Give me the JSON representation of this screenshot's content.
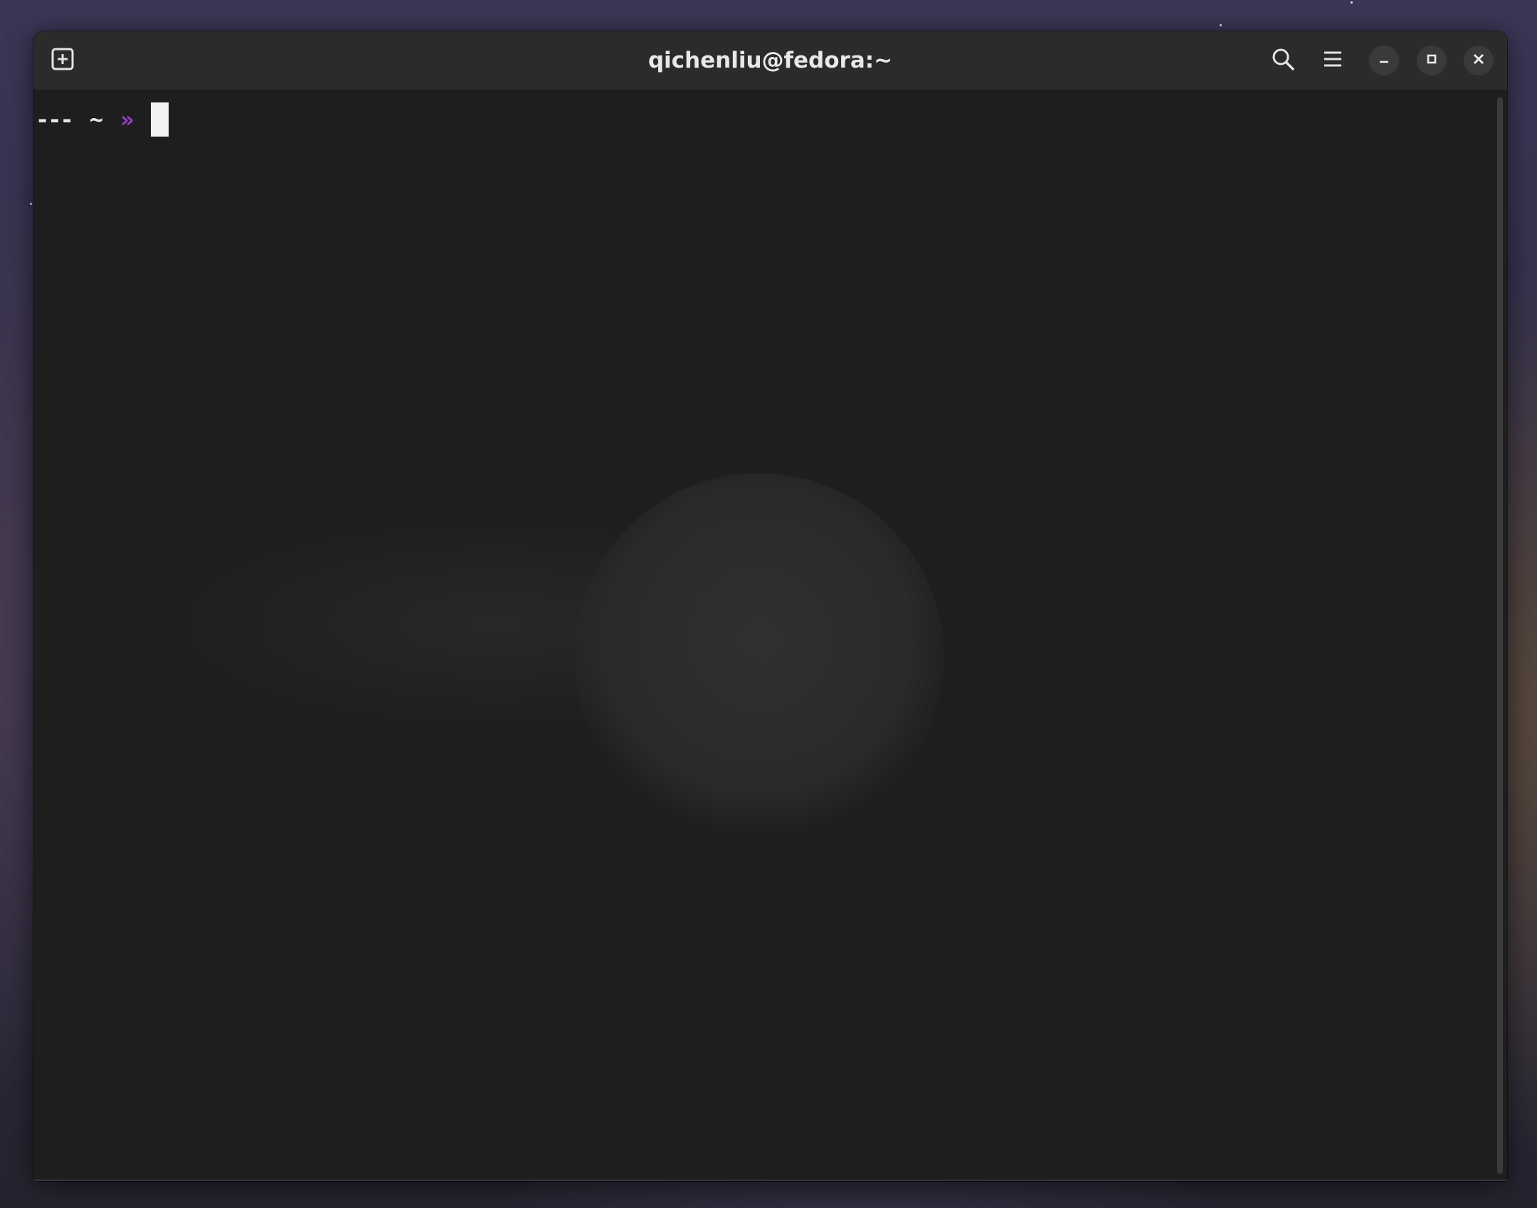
{
  "window": {
    "title": "qichenliu@fedora:~"
  },
  "headerbar": {
    "new_tab_icon": "tab-new-icon",
    "search_icon": "search-icon",
    "menu_icon": "hamburger-menu-icon",
    "minimize_icon": "minimize-icon",
    "maximize_icon": "maximize-icon",
    "close_icon": "close-icon"
  },
  "terminal": {
    "prompt_prefix": "---",
    "prompt_path": "~",
    "prompt_symbol": "»",
    "input_text": ""
  },
  "colors": {
    "prompt_symbol": "#9d3fc7",
    "terminal_bg": "#1e1e1f",
    "headerbar_bg": "#2b2b2c"
  }
}
